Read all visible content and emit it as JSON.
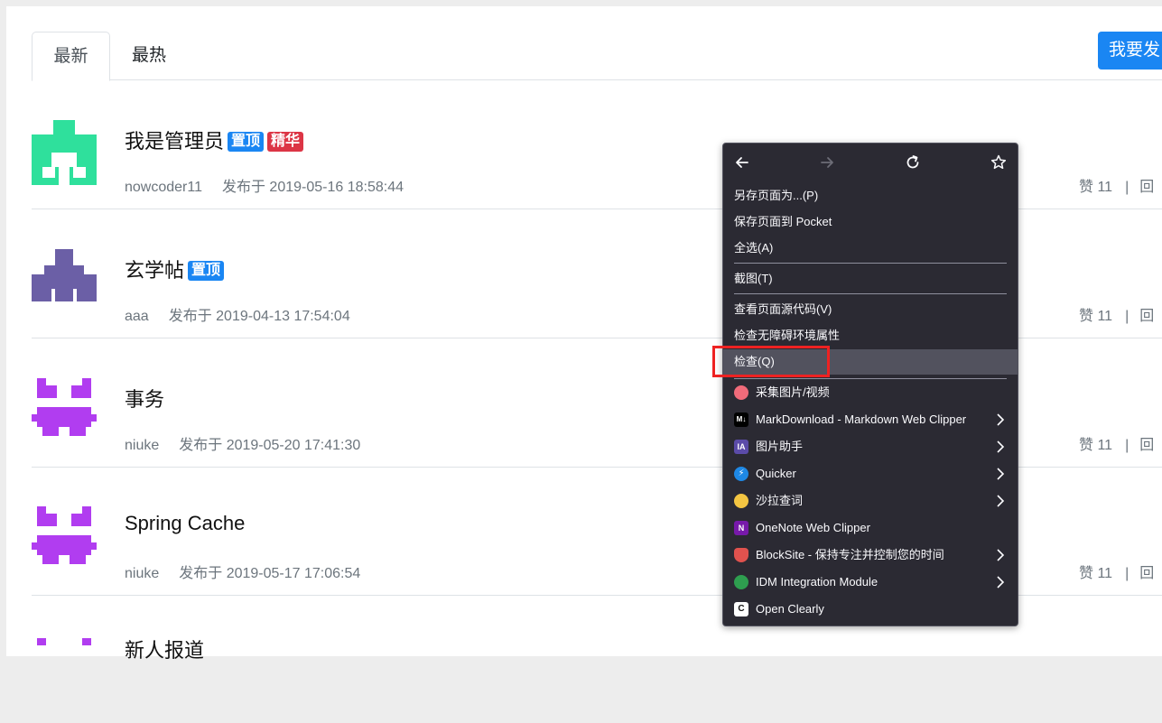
{
  "tabs": [
    {
      "label": "最新"
    },
    {
      "label": "最热"
    }
  ],
  "post_button": "我要发",
  "posts": [
    {
      "title": "我是管理员",
      "badges": [
        "置顶",
        "精华"
      ],
      "author": "nowcoder11",
      "date": "发布于 2019-05-16 18:58:44",
      "likes": "赞 11",
      "sep": "|",
      "reply": "回"
    },
    {
      "title": "玄学帖",
      "badges": [
        "置顶"
      ],
      "author": "aaa",
      "date": "发布于 2019-04-13 17:54:04",
      "likes": "赞 11",
      "sep": "|",
      "reply": "回"
    },
    {
      "title": "事务",
      "badges": [],
      "author": "niuke",
      "date": "发布于 2019-05-20 17:41:30",
      "likes": "赞 11",
      "sep": "|",
      "reply": "回"
    },
    {
      "title": "Spring Cache",
      "badges": [],
      "author": "niuke",
      "date": "发布于 2019-05-17 17:06:54",
      "likes": "赞 11",
      "sep": "|",
      "reply": "回"
    },
    {
      "title": "新人报道",
      "badges": [],
      "author": "",
      "date": "",
      "likes": "",
      "sep": "",
      "reply": ""
    }
  ],
  "colors": {
    "accent": "#1a86f3",
    "badge_top": "#1a86f3",
    "badge_essence": "#dc3545",
    "avatar_green": "#2fe09c",
    "avatar_purple": "#6b5fa6",
    "avatar_magenta": "#b13df0",
    "menu_bg": "#2b2a33",
    "highlight_box": "#ee2222"
  },
  "context_menu": {
    "nav_icons": [
      "back-arrow-icon",
      "forward-arrow-icon",
      "reload-icon",
      "bookmark-star-icon"
    ],
    "items": [
      {
        "label": "另存页面为...(P)"
      },
      {
        "label": "保存页面到 Pocket"
      },
      {
        "label": "全选(A)"
      },
      {
        "label": "截图(T)"
      },
      {
        "label": "查看页面源代码(V)"
      },
      {
        "label": "检查无障碍环境属性"
      },
      {
        "label": "检查(Q)"
      },
      {
        "label": "采集图片/视频",
        "icon": "collect-icon"
      },
      {
        "label": "MarkDownload - Markdown Web Clipper",
        "icon": "markdown-icon"
      },
      {
        "label": "图片助手",
        "icon": "image-assistant-icon"
      },
      {
        "label": "Quicker",
        "icon": "quicker-icon"
      },
      {
        "label": "沙拉查词",
        "icon": "saladict-icon"
      },
      {
        "label": "OneNote Web Clipper",
        "icon": "onenote-icon"
      },
      {
        "label": "BlockSite - 保持专注并控制您的时间",
        "icon": "blocksite-icon"
      },
      {
        "label": "IDM Integration Module",
        "icon": "idm-icon"
      },
      {
        "label": "Open Clearly",
        "icon": "clearly-icon"
      }
    ]
  }
}
